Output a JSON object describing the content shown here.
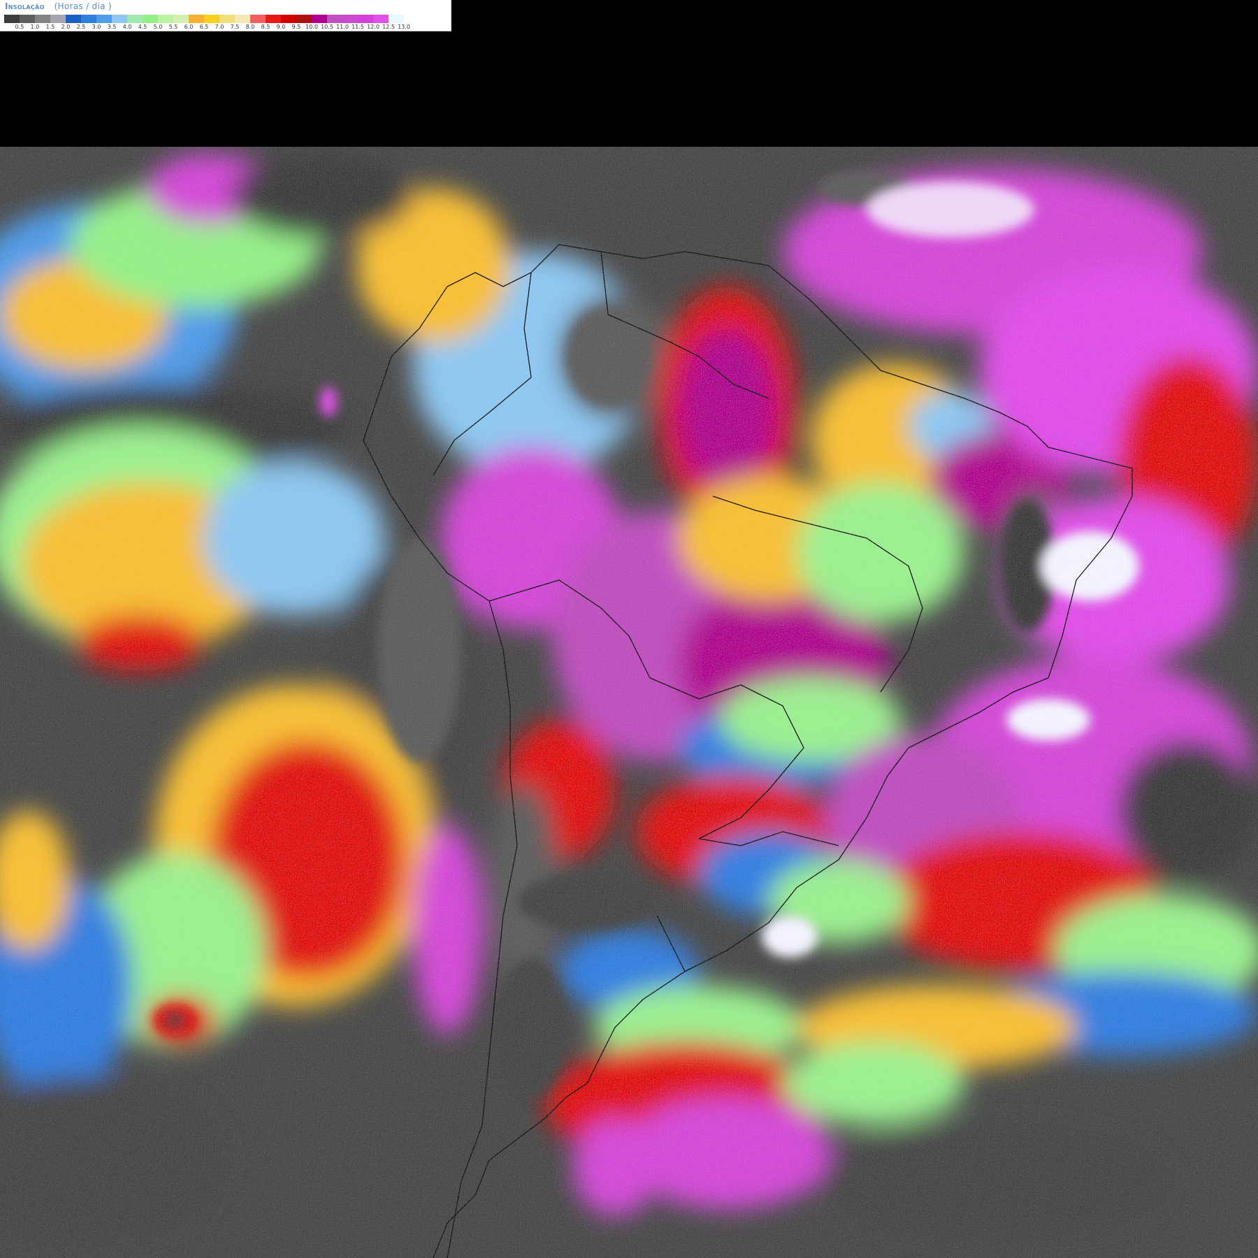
{
  "legend": {
    "title": "Insolação",
    "unit": "(Horas / dia )",
    "colors": [
      "#3c3c3c",
      "#5e5e5e",
      "#848484",
      "#a6a6ae",
      "#1a5fc4",
      "#2f7fe0",
      "#4f9ce8",
      "#8ec8f2",
      "#a2e8b0",
      "#96f08a",
      "#b8f4a2",
      "#d2f0b4",
      "#f8b030",
      "#f8d020",
      "#f4e07a",
      "#f4e8b4",
      "#f06060",
      "#e81818",
      "#d40000",
      "#b01010",
      "#b00090",
      "#c050c0",
      "#cc48cc",
      "#d440d8",
      "#e050e8",
      "#e8f8ff",
      "#ffffff"
    ],
    "ticks": [
      "0.5",
      "1.0",
      "1.5",
      "2.0",
      "2.5",
      "3.0",
      "3.5",
      "4.0",
      "4.5",
      "5.0",
      "5.5",
      "6.0",
      "6.5",
      "7.0",
      "7.5",
      "8.0",
      "8.5",
      "9.0",
      "9.5",
      "10.0",
      "10.5",
      "11.0",
      "11.5",
      "12.0",
      "12.5",
      "13.0"
    ]
  },
  "map": {
    "description_colors": {
      "ocean_dark": "#464646",
      "magenta": "#d448d8",
      "red": "#e01010",
      "yellow": "#f8c030",
      "green": "#9cf090",
      "blue": "#3080e0"
    }
  }
}
